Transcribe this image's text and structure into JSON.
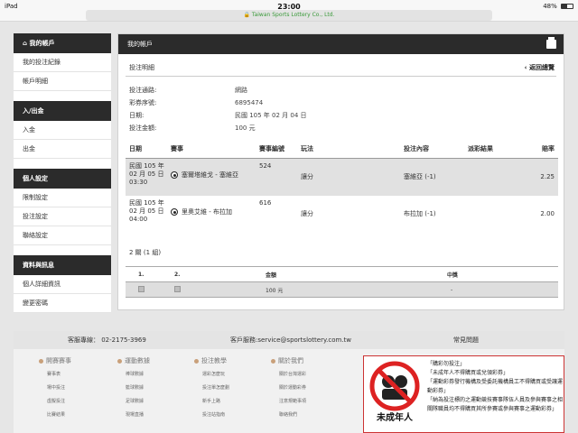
{
  "status_bar": {
    "device": "iPad",
    "time": "23:00",
    "battery": "48%",
    "battery_level": 0.48,
    "url": "Taiwan Sports Lottery Co., Ltd."
  },
  "sidebar": {
    "sections": [
      {
        "title": "我的帳戶",
        "items": [
          "我的投注紀錄",
          "帳戶明細"
        ]
      },
      {
        "title": "入/出金",
        "items": [
          "入金",
          "出金"
        ]
      },
      {
        "title": "個人設定",
        "items": [
          "限制設定",
          "投注設定",
          "聯絡設定"
        ]
      },
      {
        "title": "資料與訊息",
        "items": [
          "個人詳細資訊",
          "變更密碼"
        ]
      }
    ]
  },
  "panel": {
    "title": "我的帳戶",
    "subtitle": "投注明細",
    "back": "‹ 返回總覽",
    "info": [
      {
        "label": "投注通路:",
        "value": "網路"
      },
      {
        "label": "彩券序號:",
        "value": "6895474"
      },
      {
        "label": "日期:",
        "value": "民國 105 年 02 月 04 日"
      },
      {
        "label": "投注金額:",
        "value": "100 元"
      }
    ],
    "bet_headers": [
      "日期",
      "賽事",
      "賽事編號",
      "玩法",
      "投注內容",
      "派彩結果",
      "賠率"
    ],
    "bets": [
      {
        "date_l1": "民國 105 年",
        "date_l2": "02 月 05 日",
        "date_l3": "03:30",
        "match": "塞爾塔維戈 - 塞維亞",
        "match_no": "524",
        "play": "讓分",
        "selection": "塞維亞 (-1)",
        "result": "",
        "odds": "2.25"
      },
      {
        "date_l1": "民國 105 年",
        "date_l2": "02 月 05 日",
        "date_l3": "04:00",
        "match": "里奧艾維 - 布拉加",
        "match_no": "616",
        "play": "讓分",
        "selection": "布拉加 (-1)",
        "result": "",
        "odds": "2.00"
      }
    ],
    "combo": "2 關 (1 組)",
    "summary_headers": [
      "1.",
      "2.",
      "金額",
      "中獎"
    ],
    "summary_row": {
      "amount": "100 元",
      "win": "-"
    }
  },
  "footer": {
    "hotline": "客服專線：  02-2175-3969",
    "email": "客戶服務:service@sportslottery.com.tw",
    "faq": "常見問題",
    "columns": [
      {
        "title": "開賽賽事",
        "items": [
          "賽事表",
          "場中投注",
          "虛擬投注",
          "比賽結果"
        ]
      },
      {
        "title": "運動數據",
        "items": [
          "棒球數據",
          "籃球數據",
          "足球數據",
          "現場直播"
        ]
      },
      {
        "title": "投注教學",
        "items": [
          "運彩怎麼玩",
          "投注單怎麼劃",
          "新手上路",
          "投注站指南"
        ]
      },
      {
        "title": "關於我們",
        "items": [
          "關於台灣運彩",
          "關於運動彩券",
          "注意規範事項",
          "聯絡我們"
        ]
      }
    ],
    "warn_sign": "未成年人",
    "warn_lines": [
      "「購彩勿投注」",
      "「未成年人不得購買或兌領彩券」",
      "「運動彩券發行機構及受委託機構員工不得購買或受讓運動彩券」",
      "「納為投注標的之運動競技賽事隊伍人員及參與賽事之相關隊職員均不得購買其所參賽或參與賽事之運動彩券」"
    ]
  }
}
